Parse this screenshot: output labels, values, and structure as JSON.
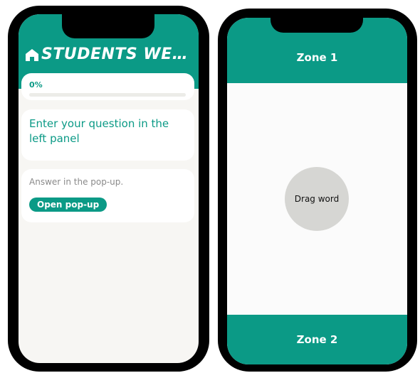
{
  "left_phone": {
    "header": {
      "title": "STUDENTS WE…",
      "icon": "home-icon"
    },
    "progress": {
      "label": "0%",
      "value": 0
    },
    "question": {
      "text": "Enter your question in the left panel"
    },
    "answer": {
      "hint": "Answer in the pop-up.",
      "button_label": "Open pop-up"
    }
  },
  "right_phone": {
    "zone_top": "Zone 1",
    "zone_bottom": "Zone 2",
    "drag_word": "Drag word"
  },
  "colors": {
    "accent": "#0b9a86",
    "background": "#f7f6f3",
    "drag_circle": "#d6d6d3"
  }
}
